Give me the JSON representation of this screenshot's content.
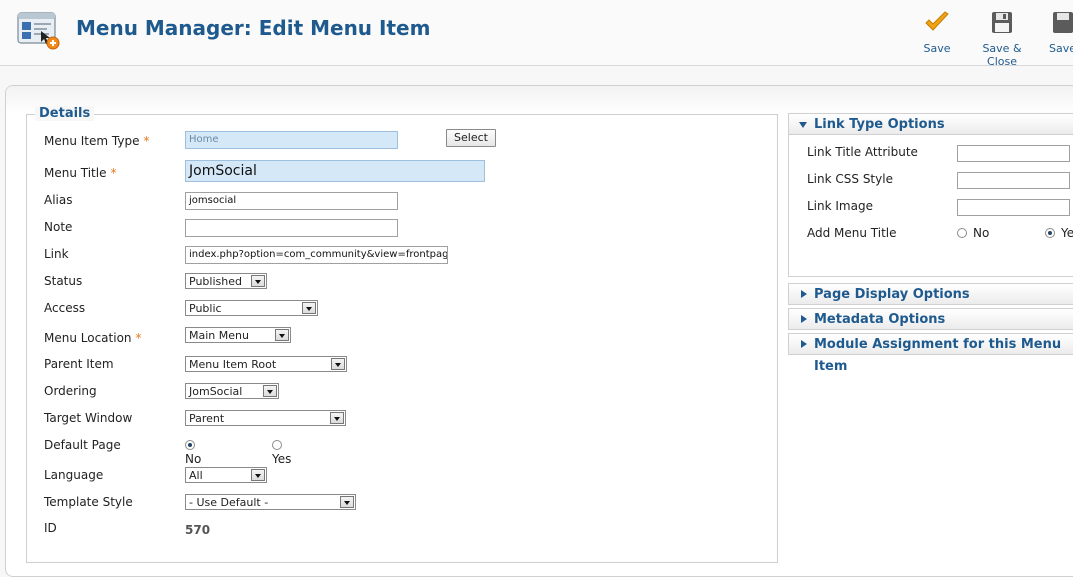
{
  "header": {
    "title": "Menu Manager: Edit Menu Item",
    "toolbar": {
      "save_label": "Save",
      "save_close_label": "Save & Close",
      "save_new_label": "Save"
    },
    "colors": {
      "title": "#1f5a8f",
      "check": "#f0a215"
    }
  },
  "details": {
    "legend": "Details",
    "fields": {
      "menu_item_type": {
        "label": "Menu Item Type",
        "value": "Home",
        "button": "Select"
      },
      "menu_title": {
        "label": "Menu Title",
        "value": "JomSocial"
      },
      "alias": {
        "label": "Alias",
        "value": "jomsocial"
      },
      "note": {
        "label": "Note",
        "value": ""
      },
      "link": {
        "label": "Link",
        "value": "index.php?option=com_community&view=frontpage"
      },
      "status": {
        "label": "Status",
        "value": "Published"
      },
      "access": {
        "label": "Access",
        "value": "Public"
      },
      "menu_location": {
        "label": "Menu Location",
        "value": "Main Menu"
      },
      "parent_item": {
        "label": "Parent Item",
        "value": "Menu Item Root"
      },
      "ordering": {
        "label": "Ordering",
        "value": "JomSocial"
      },
      "target_window": {
        "label": "Target Window",
        "value": "Parent"
      },
      "default_page": {
        "label": "Default Page",
        "option_no": "No",
        "option_yes": "Yes",
        "selected": "No"
      },
      "language": {
        "label": "Language",
        "value": "All"
      },
      "template_style": {
        "label": "Template Style",
        "value": "- Use Default -"
      },
      "id": {
        "label": "ID",
        "value": "570"
      }
    },
    "required_mark": "*"
  },
  "right_panel": {
    "link_type": {
      "title": "Link Type Options",
      "link_title_attribute": "Link Title Attribute",
      "link_css_style": "Link CSS Style",
      "link_image": "Link Image",
      "add_menu_title": "Add Menu Title",
      "no": "No",
      "yes": "Ye",
      "selected": "Yes"
    },
    "page_display": "Page Display Options",
    "metadata": "Metadata Options",
    "module_assignment": "Module Assignment for this Menu Item"
  }
}
